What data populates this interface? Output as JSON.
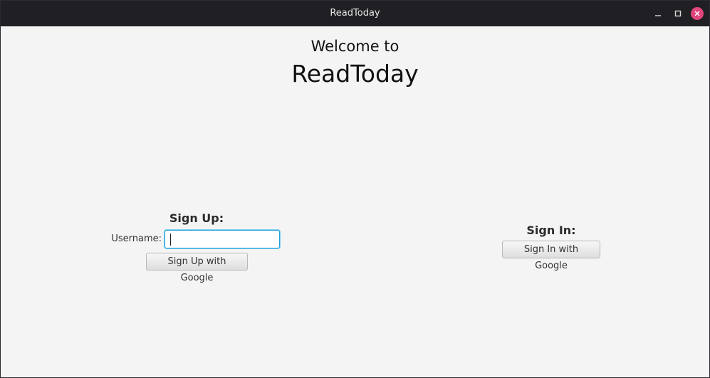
{
  "window": {
    "title": "ReadToday"
  },
  "header": {
    "welcome": "Welcome to",
    "app_name": "ReadToday"
  },
  "signup": {
    "title": "Sign Up:",
    "username_label": "Username:",
    "username_value": "",
    "button_label": "Sign Up with Google"
  },
  "signin": {
    "title": "Sign In:",
    "button_label": "Sign In with Google"
  },
  "colors": {
    "titlebar_bg": "#202024",
    "content_bg": "#f4f4f4",
    "close_button": "#e0457b",
    "focus_border": "#1fa0d8"
  },
  "icons": {
    "minimize": "minimize-icon",
    "maximize": "maximize-icon",
    "close": "close-icon"
  }
}
